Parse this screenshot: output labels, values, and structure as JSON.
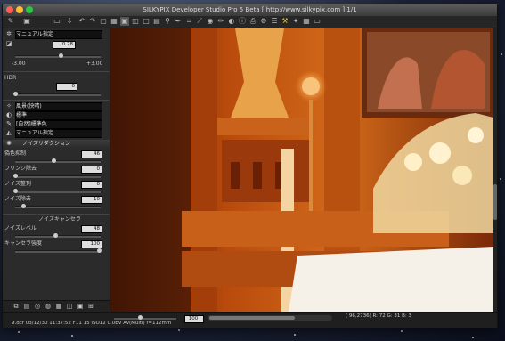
{
  "window": {
    "title": "SILKYPIX Developer Studio Pro 5 Beta [ http://www.silkypix.com ]   1/1",
    "traffic_colors": [
      "#ff5f57",
      "#febc2e",
      "#28c840"
    ]
  },
  "toolbar": {
    "icons": [
      "folder-icon",
      "import-icon",
      "rotate-left-icon",
      "rotate-right-icon",
      "view-single-icon",
      "view-grid-icon",
      "view-thumbs-icon",
      "view-compare-icon",
      "view-full-icon",
      "zoom-icon",
      "eyedropper-icon",
      "crop-icon",
      "straighten-icon",
      "spot-icon",
      "brush-icon",
      "gradient-icon",
      "info-icon",
      "print-icon",
      "develop-icon",
      "batch-icon",
      "settings-icon",
      "monitor-icon"
    ]
  },
  "panel": {
    "exposure_preset": "マニュアル指定",
    "exposure_value": "0.28",
    "exposure_min": "-3.00",
    "exposure_max": "+3.00",
    "exposure_level": 0.54,
    "hdr_label": "HDR",
    "hdr_value": "0",
    "hdr_level": 0.0,
    "presets": [
      "風景(快晴)",
      "標準",
      "[自然]標準色",
      "マニュアル指定"
    ],
    "noise_header": "ノイズリダクション",
    "noise_rows": [
      {
        "label": "偽色抑制",
        "value": "46",
        "level": 0.46
      },
      {
        "label": "フリンジ除去",
        "value": "0",
        "level": 0.0
      },
      {
        "label": "ノイズ整列",
        "value": "0",
        "level": 0.0
      },
      {
        "label": "ノイズ除去",
        "value": "10",
        "level": 0.1
      }
    ],
    "cancel_header": "ノイズキャンセラ",
    "cancel_rows": [
      {
        "label": "ノイズレベル",
        "value": "48",
        "level": 0.48
      },
      {
        "label": "キャンセラ強度",
        "value": "100",
        "level": 1.0
      }
    ]
  },
  "status": {
    "file_info": "9.dcr 03/12/30 11:37:52 F11 15 ISO12 0.0EV Av(Multi) f=112mm",
    "zoom": "100",
    "pixel_info": "( 96,2736) R: 72 G: 31 B:  3"
  }
}
